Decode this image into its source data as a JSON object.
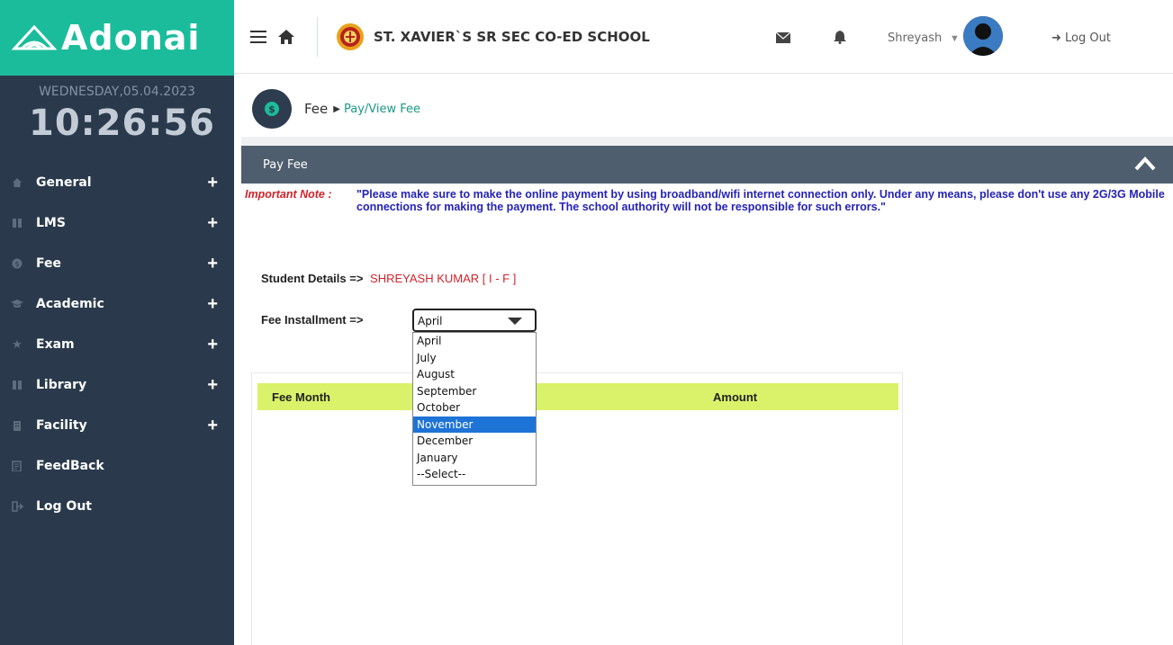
{
  "brand": {
    "name": "Adonai"
  },
  "clock": {
    "date": "WEDNESDAY,05.04.2023",
    "time": "10:26:56"
  },
  "sidebar": {
    "items": [
      {
        "label": "General",
        "icon": "home-icon",
        "expandable": true
      },
      {
        "label": "LMS",
        "icon": "book-icon",
        "expandable": true
      },
      {
        "label": "Fee",
        "icon": "money-icon",
        "expandable": true
      },
      {
        "label": "Academic",
        "icon": "graduation-cap-icon",
        "expandable": true
      },
      {
        "label": "Exam",
        "icon": "star-icon",
        "expandable": true
      },
      {
        "label": "Library",
        "icon": "book-icon",
        "expandable": true
      },
      {
        "label": "Facility",
        "icon": "building-icon",
        "expandable": true
      },
      {
        "label": "FeedBack",
        "icon": "edit-icon",
        "expandable": false
      },
      {
        "label": "Log Out",
        "icon": "sign-out-icon",
        "expandable": false
      }
    ]
  },
  "header": {
    "school_name": "ST. XAVIER`S SR SEC CO-ED SCHOOL",
    "user_name": "Shreyash",
    "logout_label": "Log Out"
  },
  "breadcrumb": {
    "section": "Fee",
    "page": "Pay/View Fee"
  },
  "panel": {
    "title": "Pay Fee",
    "note_label": "Important Note :",
    "note_text": "\"Please make sure to make the online payment by using broadband/wifi internet connection only. Under any means, please don't use any 2G/3G Mobile connections for making the payment. The school authority will not be responsible for such errors.\""
  },
  "student": {
    "label": "Student Details =>",
    "name": "SHREYASH KUMAR  [ I - F ]"
  },
  "installment": {
    "label": "Fee Installment =>",
    "selected": "April",
    "options": [
      "April",
      "July",
      "August",
      "September",
      "October",
      "November",
      "December",
      "January",
      "--Select--"
    ],
    "highlighted": "November"
  },
  "table": {
    "columns": [
      "Fee Month",
      "Amount"
    ]
  },
  "colors": {
    "brand": "#1bbc9b",
    "sidebar": "#2a3a4c",
    "panel_header": "#4e5e6e",
    "table_header": "#d9f26a",
    "note_red": "#d2232a",
    "note_blue": "#2523b5",
    "highlight": "#1e73d6"
  }
}
